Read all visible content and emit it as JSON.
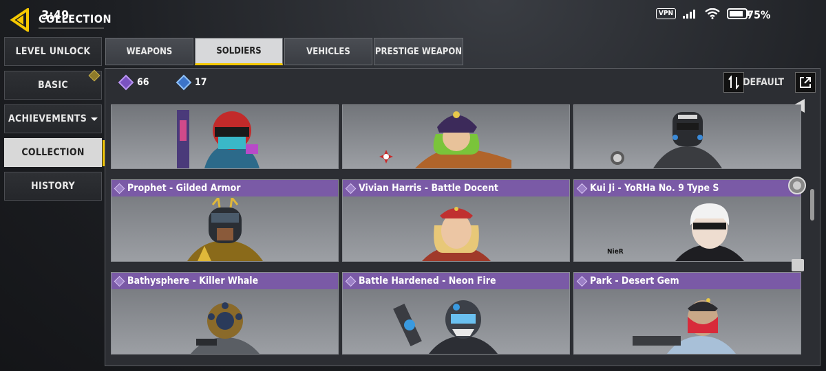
{
  "status": {
    "time": "3:49",
    "vpn": "VPN",
    "battery": "75%"
  },
  "page_title": "COLLECTION",
  "nav": [
    {
      "label": "LEVEL UNLOCK",
      "active": false
    },
    {
      "label": "BASIC",
      "active": false,
      "badge": true
    },
    {
      "label": "ACHIEVEMENTS",
      "active": false,
      "caret": true
    },
    {
      "label": "COLLECTION",
      "active": true
    },
    {
      "label": "HISTORY",
      "active": false
    }
  ],
  "tabs": [
    {
      "label": "WEAPONS",
      "active": false
    },
    {
      "label": "SOLDIERS",
      "active": true
    },
    {
      "label": "VEHICLES",
      "active": false
    },
    {
      "label": "PRESTIGE WEAPON",
      "active": false
    }
  ],
  "currency": {
    "purple": {
      "value": "66",
      "color": "#9b6fe0"
    },
    "blue": {
      "value": "17",
      "color": "#4f8fe0"
    }
  },
  "sort": {
    "label": "DEFAULT"
  },
  "cards": [
    {
      "title": "",
      "figure": "red-helmet-soldier"
    },
    {
      "title": "",
      "figure": "green-hair-soldier"
    },
    {
      "title": "",
      "figure": "armored-soldier"
    },
    {
      "title": "Prophet - Gilded Armor",
      "figure": "gilded-armor-soldier"
    },
    {
      "title": "Vivian Harris - Battle Docent",
      "figure": "vivian-soldier"
    },
    {
      "title": "Kui Ji - YoRHa No. 9 Type S",
      "figure": "kuiji-soldier",
      "logo": "NieR"
    },
    {
      "title": "Bathysphere - Killer Whale",
      "figure": "diver-soldier"
    },
    {
      "title": "Battle Hardened - Neon Fire",
      "figure": "neon-soldier"
    },
    {
      "title": "Park - Desert Gem",
      "figure": "park-soldier"
    }
  ]
}
